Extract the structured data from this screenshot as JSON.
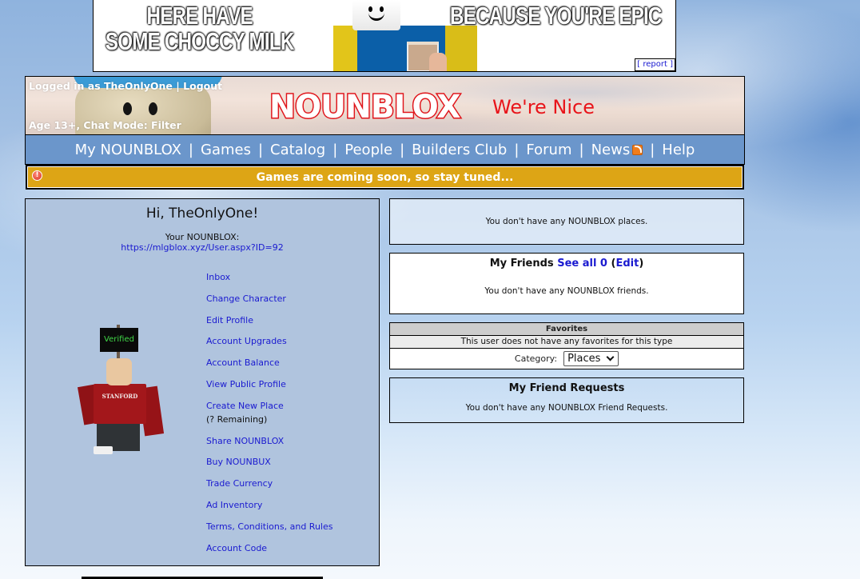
{
  "ad": {
    "line1": "HERE HAVE",
    "line2": "SOME CHOCCY MILK",
    "right_text": "BECAUSE YOU'RE EPIC",
    "report_label": "[ report ]"
  },
  "header": {
    "logged_in_prefix": "Logged in as ",
    "username": "TheOnlyOne",
    "separator": " | ",
    "logout_label": "Logout",
    "age_chat": "Age 13+, Chat Mode: Filter",
    "logo_text": "NOUNBLOX",
    "slogan": "We're Nice"
  },
  "nav": {
    "items": [
      {
        "label": "My NOUNBLOX"
      },
      {
        "label": "Games"
      },
      {
        "label": "Catalog"
      },
      {
        "label": "People"
      },
      {
        "label": "Builders Club"
      },
      {
        "label": "Forum"
      },
      {
        "label": "News",
        "icon": "rss-icon"
      },
      {
        "label": "Help"
      }
    ],
    "separator": "|"
  },
  "alert": {
    "icon": "alert-icon",
    "message": "Games are coming soon, so stay tuned..."
  },
  "profile": {
    "greeting": "Hi, TheOnlyOne!",
    "your_label": "Your NOUNBLOX:",
    "profile_url": "https://mlgblox.xyz/User.aspx?ID=92",
    "avatar_sign": "Verified",
    "avatar_shirt": "STANFORD",
    "menu": [
      {
        "label": "Inbox"
      },
      {
        "label": "Change Character"
      },
      {
        "label": "Edit Profile"
      },
      {
        "label": "Account Upgrades"
      },
      {
        "label": "Account Balance"
      },
      {
        "label": "View Public Profile"
      },
      {
        "label": "Create New Place",
        "sub": "(? Remaining)"
      },
      {
        "label": "Share NOUNBLOX"
      },
      {
        "label": "Buy NOUNBUX"
      },
      {
        "label": "Trade Currency"
      },
      {
        "label": "Ad Inventory"
      },
      {
        "label": "Terms, Conditions, and Rules"
      },
      {
        "label": "Account Code"
      }
    ]
  },
  "places": {
    "empty_message": "You don't have any NOUNBLOX places."
  },
  "friends": {
    "title": "My Friends",
    "see_all_label": "See all 0",
    "edit_open": "(",
    "edit_label": "Edit",
    "edit_close": ")",
    "empty_message": "You don't have any NOUNBLOX friends."
  },
  "favorites": {
    "title": "Favorites",
    "empty_message": "This user does not have any favorites for this type",
    "category_label": "Category:",
    "category_selected": "Places"
  },
  "friend_requests": {
    "title": "My Friend Requests",
    "empty_message": "You don't have any NOUNBLOX Friend Requests."
  },
  "colors": {
    "nav_bg": "#6b96cb",
    "alert_bg": "#dda515",
    "panel_bg": "#b0c4de",
    "link": "#1a1ad0",
    "logo_red": "#e0141a"
  }
}
